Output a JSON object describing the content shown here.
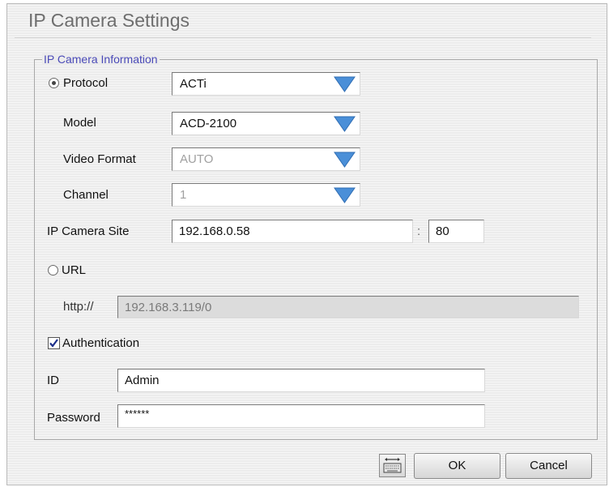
{
  "window": {
    "title": "IP Camera Settings"
  },
  "group": {
    "legend": "IP Camera Information"
  },
  "protocol": {
    "label": "Protocol",
    "value": "ACTi",
    "selected": true
  },
  "model": {
    "label": "Model",
    "value": "ACD-2100"
  },
  "video_format": {
    "label": "Video Format",
    "value": "AUTO"
  },
  "channel": {
    "label": "Channel",
    "value": "1"
  },
  "ip_site": {
    "label": "IP Camera Site",
    "address": "192.168.0.58",
    "separator": ":",
    "port": "80"
  },
  "url": {
    "label": "URL",
    "prefix": "http://",
    "value": "192.168.3.119/0",
    "selected": false
  },
  "authentication": {
    "label": "Authentication",
    "checked": true
  },
  "id_field": {
    "label": "ID",
    "value": "Admin"
  },
  "password": {
    "label": "Password",
    "value": "******"
  },
  "buttons": {
    "ok": "OK",
    "cancel": "Cancel",
    "keyboard_icon": "keyboard-icon"
  },
  "colors": {
    "legend": "#4a4ab8",
    "arrow": "#4a8fd8",
    "title": "#6e6e6e"
  }
}
